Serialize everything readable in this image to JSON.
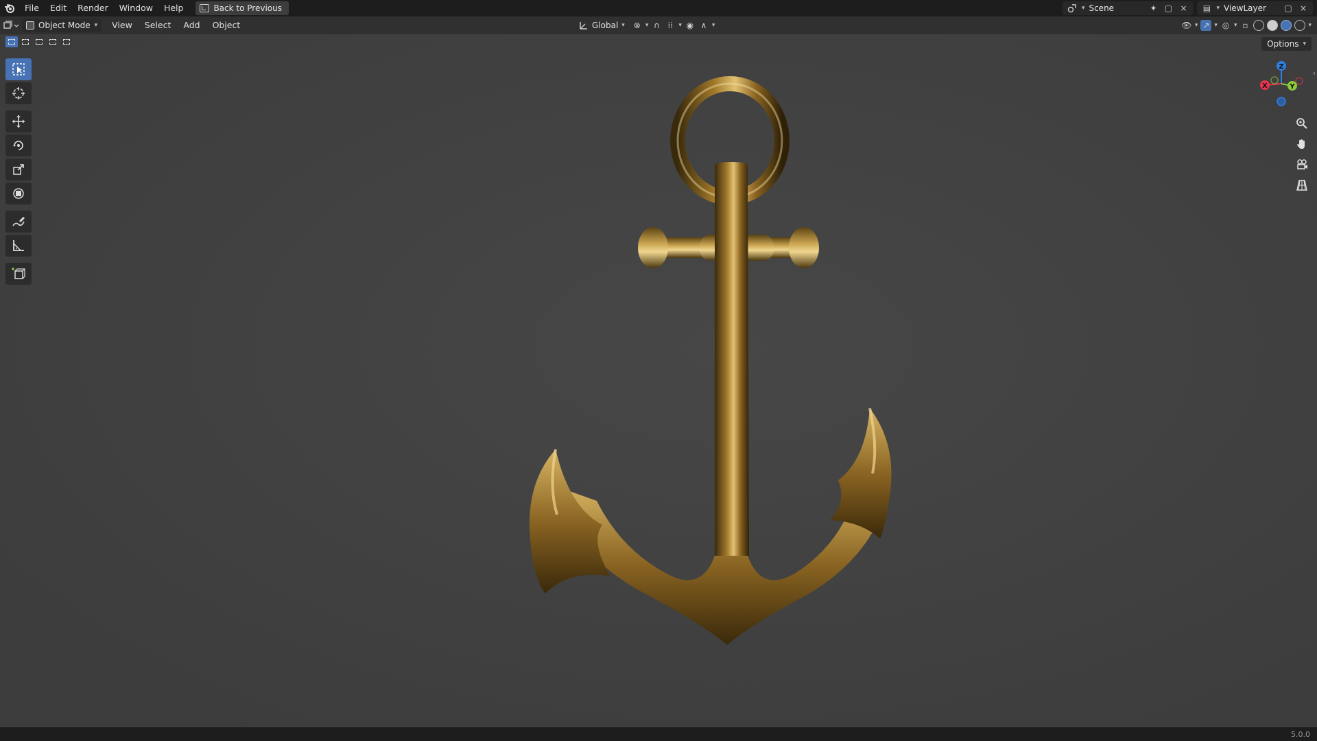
{
  "topbar": {
    "menus": [
      "File",
      "Edit",
      "Render",
      "Window",
      "Help"
    ],
    "back_label": "Back to Previous",
    "scene": "Scene",
    "view_layer": "ViewLayer"
  },
  "header": {
    "mode": "Object Mode",
    "menus": [
      "View",
      "Select",
      "Add",
      "Object"
    ],
    "orientation": "Global"
  },
  "viewport": {
    "options_label": "Options",
    "gizmo": {
      "x": "X",
      "y": "Y",
      "z": "Z"
    },
    "colors": {
      "x_axis": "#e8344e",
      "y_axis": "#8bc93a",
      "z_axis": "#2f7fe0",
      "active_tool": "#4772b3"
    }
  },
  "status": {
    "version": "5.0.0"
  }
}
